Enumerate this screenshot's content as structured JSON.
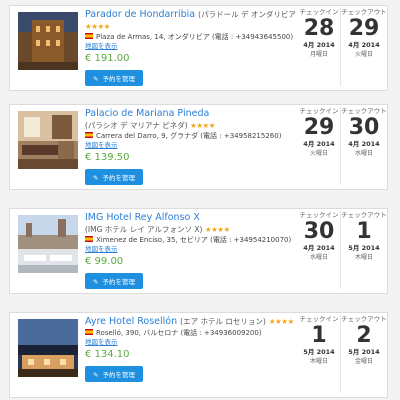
{
  "hotels": [
    {
      "name_en": "Parador de Hondarribia",
      "name_ja": "(パラドール デ オンダリビア)",
      "stars": "★★★★",
      "address": "Plaza de Armas, 14, オンダリビア (電話 : +34943645500)",
      "map_label": "地図を表示",
      "price": "€ 191.00",
      "book_label": "予約を管理",
      "checkin_label": "チェックイン",
      "checkin_day": "28",
      "checkin_month": "4月 2014",
      "checkin_dow": "月曜日",
      "checkout_label": "チェックアウト",
      "checkout_day": "29",
      "checkout_month": "4月 2014",
      "checkout_dow": "火曜日"
    },
    {
      "name_en": "Palacio de Mariana Pineda",
      "name_ja": "(パラシオ デ マリアナ ピネダ)",
      "stars": "★★★★",
      "address": "Carrera del Darro, 9, グラナダ (電話 : +34958215260)",
      "map_label": "地図を表示",
      "price": "€ 139.50",
      "book_label": "予約を管理",
      "checkin_label": "チェックイン",
      "checkin_day": "29",
      "checkin_month": "4月 2014",
      "checkin_dow": "火曜日",
      "checkout_label": "チェックアウト",
      "checkout_day": "30",
      "checkout_month": "4月 2014",
      "checkout_dow": "水曜日"
    },
    {
      "name_en": "IMG Hotel Rey Alfonso X",
      "name_ja": "(IMG ホテル レイ アルフォンソ X)",
      "stars": "★★★★",
      "address": "Ximenez de Enciso, 35, セビリア (電話 : +34954210070)",
      "map_label": "地図を表示",
      "price": "€ 99.00",
      "book_label": "予約を管理",
      "checkin_label": "チェックイン",
      "checkin_day": "30",
      "checkin_month": "4月 2014",
      "checkin_dow": "水曜日",
      "checkout_label": "チェックアウト",
      "checkout_day": "1",
      "checkout_month": "5月 2014",
      "checkout_dow": "木曜日"
    },
    {
      "name_en": "Ayre Hotel Rosellón",
      "name_ja": "(エア ホテル ロセリョン)",
      "stars": "★★★★",
      "address": "Roselló, 390, バルセロナ (電話 : +34936009200)",
      "map_label": "地図を表示",
      "price": "€ 134.10",
      "book_label": "予約を管理",
      "checkin_label": "チェックイン",
      "checkin_day": "1",
      "checkin_month": "5月 2014",
      "checkin_dow": "木曜日",
      "checkout_label": "チェックアウト",
      "checkout_day": "2",
      "checkout_month": "5月 2014",
      "checkout_dow": "金曜日"
    }
  ],
  "colors": {
    "link": "#2a7fd4",
    "price": "#5cab3c",
    "button": "#1f8fdf",
    "star": "#f0a71f"
  },
  "icons": {
    "flag": "spain-flag-icon",
    "button": "pencil-icon"
  }
}
